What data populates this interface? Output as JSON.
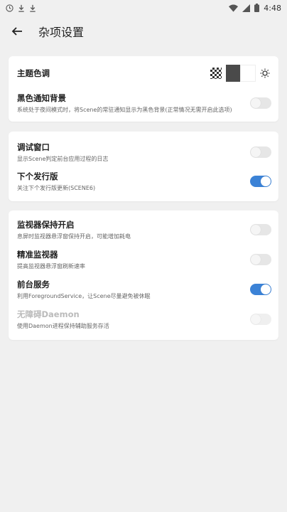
{
  "status_bar": {
    "time": "4:48",
    "icons": [
      "clock-icon",
      "download-icon",
      "download-icon",
      "wifi-icon",
      "signal-icon",
      "battery-icon"
    ]
  },
  "header": {
    "title": "杂项设置",
    "back_icon": "arrow-left-icon"
  },
  "theme": {
    "title": "主题色调",
    "options": [
      "checker-pattern",
      "dark",
      "light",
      "sun-icon"
    ],
    "colors": {
      "dark": "#4a4a4a",
      "light": "#ffffff"
    }
  },
  "groups": [
    {
      "items": [
        {
          "title": "黑色通知背景",
          "desc": "系统处于夜间模式时，将Scene的常驻通知显示为黑色背景(正常情况无需开启此选项)",
          "enabled": false
        }
      ]
    },
    {
      "items": [
        {
          "title": "调试窗口",
          "desc": "显示Scene判定前台应用过程的日志",
          "enabled": false
        },
        {
          "title": "下个发行版",
          "desc": "关注下个发行版更新(SCENE6)",
          "enabled": true
        }
      ]
    },
    {
      "items": [
        {
          "title": "监视器保持开启",
          "desc": "息屏时监视器悬浮窗保持开启，可能增加耗电",
          "enabled": false
        },
        {
          "title": "精准监视器",
          "desc": "提高监视器悬浮窗刷新速率",
          "enabled": false
        },
        {
          "title": "前台服务",
          "desc": "利用ForegroundService，让Scene尽量避免被休眠",
          "enabled": true
        },
        {
          "title": "无障碍Daemon",
          "desc": "使用Daemon进程保持辅助服务存活",
          "enabled": false,
          "disabled": true
        }
      ]
    }
  ],
  "colors": {
    "accent": "#3b82d6",
    "background": "#f0f0f0",
    "card": "#ffffff"
  }
}
